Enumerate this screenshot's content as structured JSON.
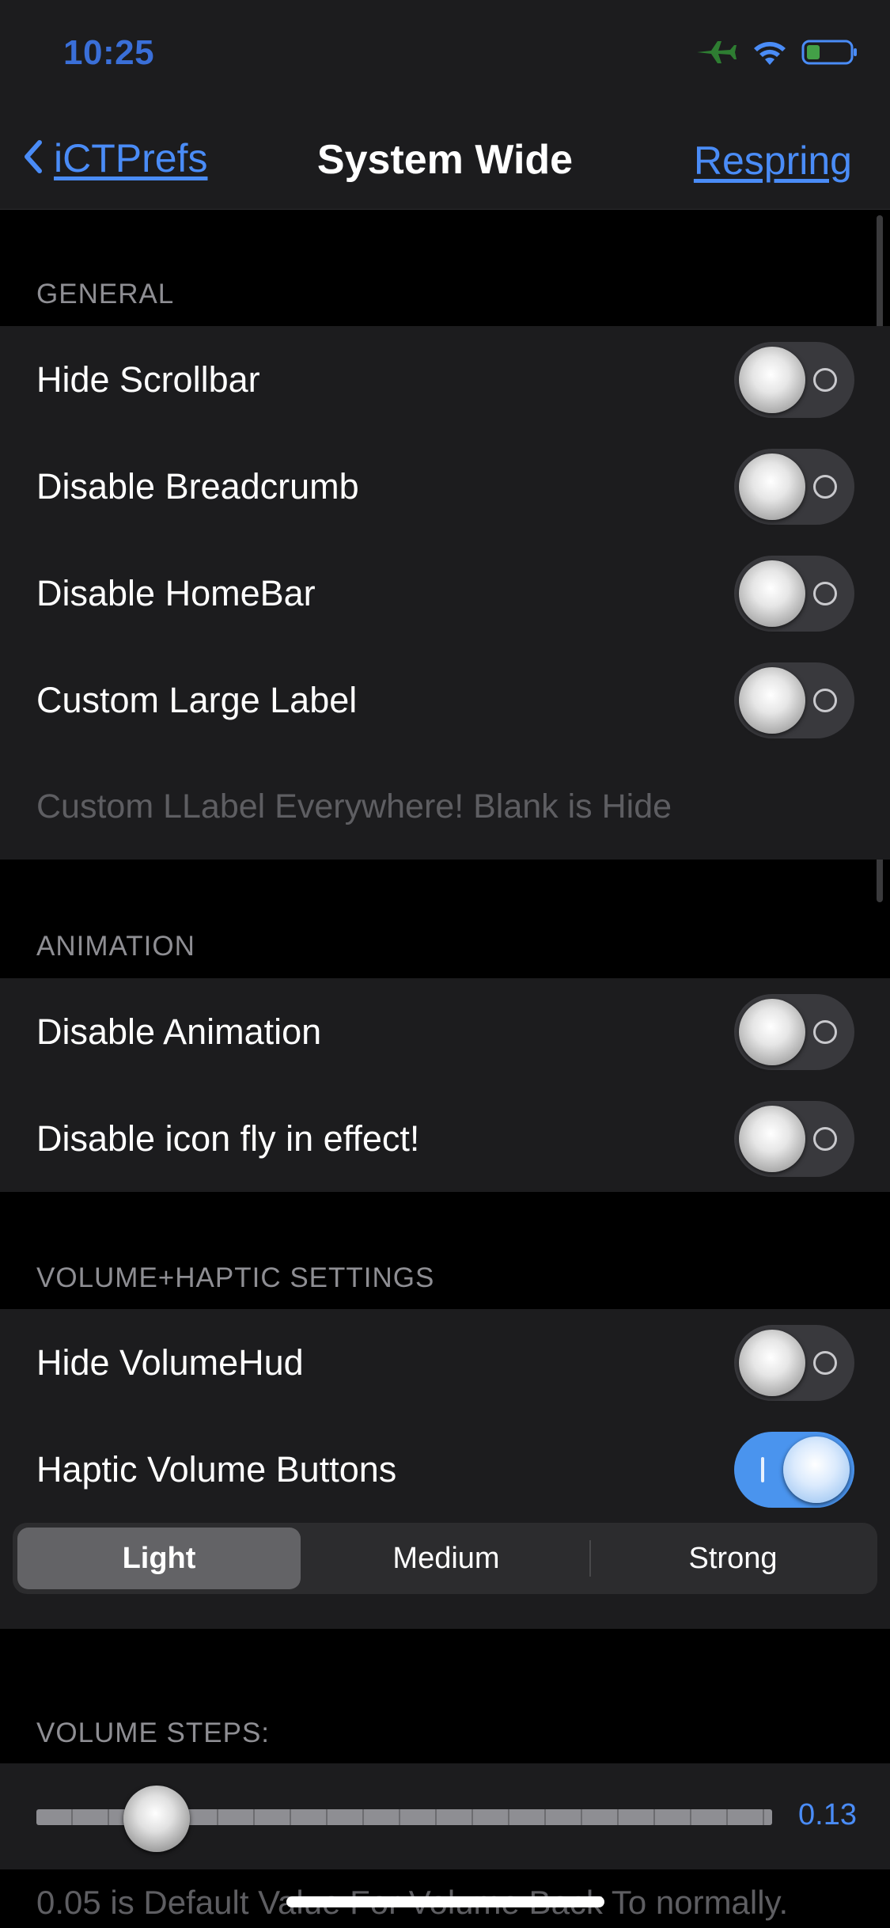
{
  "status_bar": {
    "time": "10:25",
    "icons": [
      "airplane-icon",
      "wifi-icon",
      "battery-icon"
    ],
    "colors": {
      "time": "#3a6fd8",
      "airplane": "#2e7d32",
      "wifi": "#4a8cf7",
      "battery": "#4a8cf7",
      "battery_fill": "#43a047"
    }
  },
  "nav": {
    "back_label": "iCTPrefs",
    "title": "System Wide",
    "right_label": "Respring"
  },
  "sections": {
    "general": {
      "header": "GENERAL",
      "rows": [
        {
          "label": "Hide Scrollbar",
          "on": false
        },
        {
          "label": "Disable Breadcrumb",
          "on": false
        },
        {
          "label": "Disable HomeBar",
          "on": false
        },
        {
          "label": "Custom Large Label",
          "on": false
        }
      ],
      "placeholder": "Custom LLabel Everywhere! Blank is Hide"
    },
    "animation": {
      "header": "ANIMATION",
      "rows": [
        {
          "label": "Disable Animation",
          "on": false
        },
        {
          "label": "Disable icon fly in effect!",
          "on": false
        }
      ]
    },
    "volume_haptic": {
      "header": "VOLUME+HAPTIC SETTINGS",
      "rows": [
        {
          "label": "Hide VolumeHud",
          "on": false
        },
        {
          "label": "Haptic Volume Buttons",
          "on": true
        }
      ],
      "segments": [
        "Light",
        "Medium",
        "Strong"
      ],
      "selected_segment": "Light"
    },
    "volume_steps": {
      "header": "VOLUME STEPS:",
      "slider_value": "0.13",
      "slider_fraction": 0.13,
      "footer": "0.05 is Default Value For Volume Back To normally."
    }
  },
  "colors": {
    "accent": "#4a8cf7",
    "toggle_on": "#4a94ee",
    "toggle_off": "#39393d",
    "cell_bg": "#1c1c1e",
    "page_bg": "#000000"
  }
}
